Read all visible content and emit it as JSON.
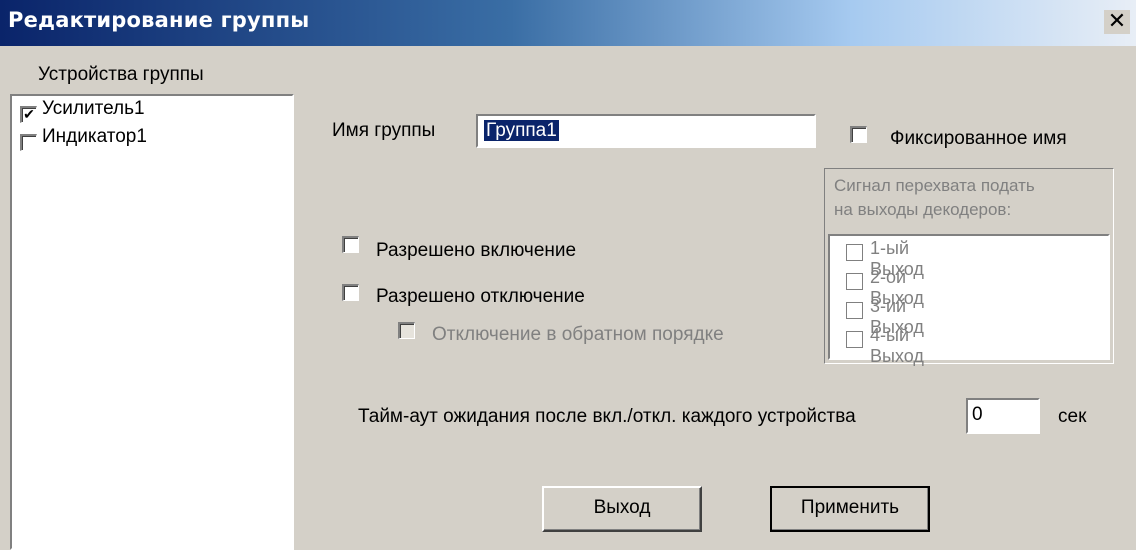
{
  "window": {
    "title": "Редактирование группы",
    "close_glyph": "✕"
  },
  "devices": {
    "heading": "Устройства группы",
    "items": [
      {
        "label": "Усилитель1",
        "checked": true
      },
      {
        "label": "Индикатор1",
        "checked": false
      }
    ]
  },
  "group_name": {
    "label": "Имя группы",
    "value": "Группа1",
    "fixed_name_label": "Фиксированное имя",
    "fixed_name_checked": false
  },
  "options": {
    "enable_on_label": "Разрешено включение",
    "enable_off_label": "Разрешено отключение",
    "reverse_order_label": "Отключение в обратном порядке"
  },
  "intercept": {
    "caption_line1": "Сигнал перехвата подать",
    "caption_line2": "на выходы декодеров:",
    "outputs": [
      {
        "label": "1-ый Выход"
      },
      {
        "label": "2-ой Выход"
      },
      {
        "label": "3-ий Выход"
      },
      {
        "label": "4-ый Выход"
      }
    ]
  },
  "timeout": {
    "label": "Тайм-аут ожидания после вкл./откл. каждого устройства",
    "value": "0",
    "unit": "сек"
  },
  "buttons": {
    "exit": "Выход",
    "apply": "Применить"
  },
  "colors": {
    "title_bar_start": "#0a246a",
    "title_bar_end": "#a6caf0",
    "dialog_bg": "#d4d0c8",
    "disabled_text": "#808080"
  }
}
